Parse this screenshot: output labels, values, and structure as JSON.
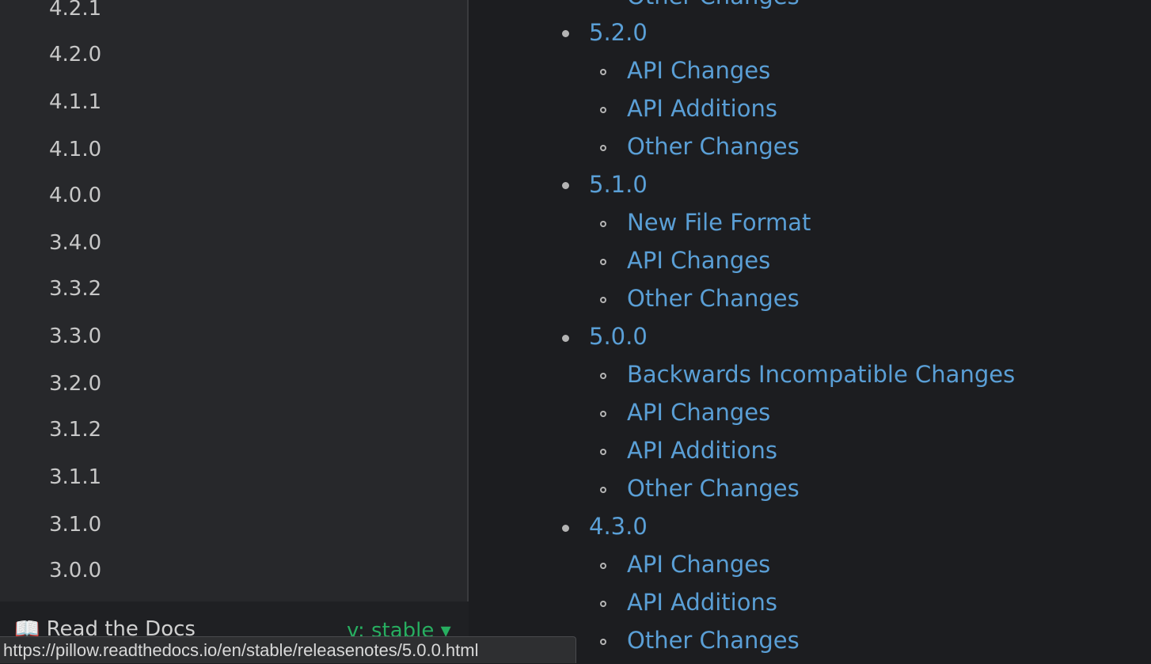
{
  "sidebar": {
    "versions": [
      "4.2.1",
      "4.2.0",
      "4.1.1",
      "4.1.0",
      "4.0.0",
      "3.4.0",
      "3.3.2",
      "3.3.0",
      "3.2.0",
      "3.1.2",
      "3.1.1",
      "3.1.0",
      "3.0.0"
    ]
  },
  "rtd": {
    "brand": "Read the Docs",
    "version": "v: stable ▾"
  },
  "status_url": "https://pillow.readthedocs.io/en/stable/releasenotes/5.0.0.html",
  "release_notes": [
    {
      "version": "",
      "sections": [
        "Other Changes"
      ]
    },
    {
      "version": "5.2.0",
      "sections": [
        "API Changes",
        "API Additions",
        "Other Changes"
      ]
    },
    {
      "version": "5.1.0",
      "sections": [
        "New File Format",
        "API Changes",
        "Other Changes"
      ]
    },
    {
      "version": "5.0.0",
      "sections": [
        "Backwards Incompatible Changes",
        "API Changes",
        "API Additions",
        "Other Changes"
      ]
    },
    {
      "version": "4.3.0",
      "sections": [
        "API Changes",
        "API Additions",
        "Other Changes"
      ]
    }
  ]
}
